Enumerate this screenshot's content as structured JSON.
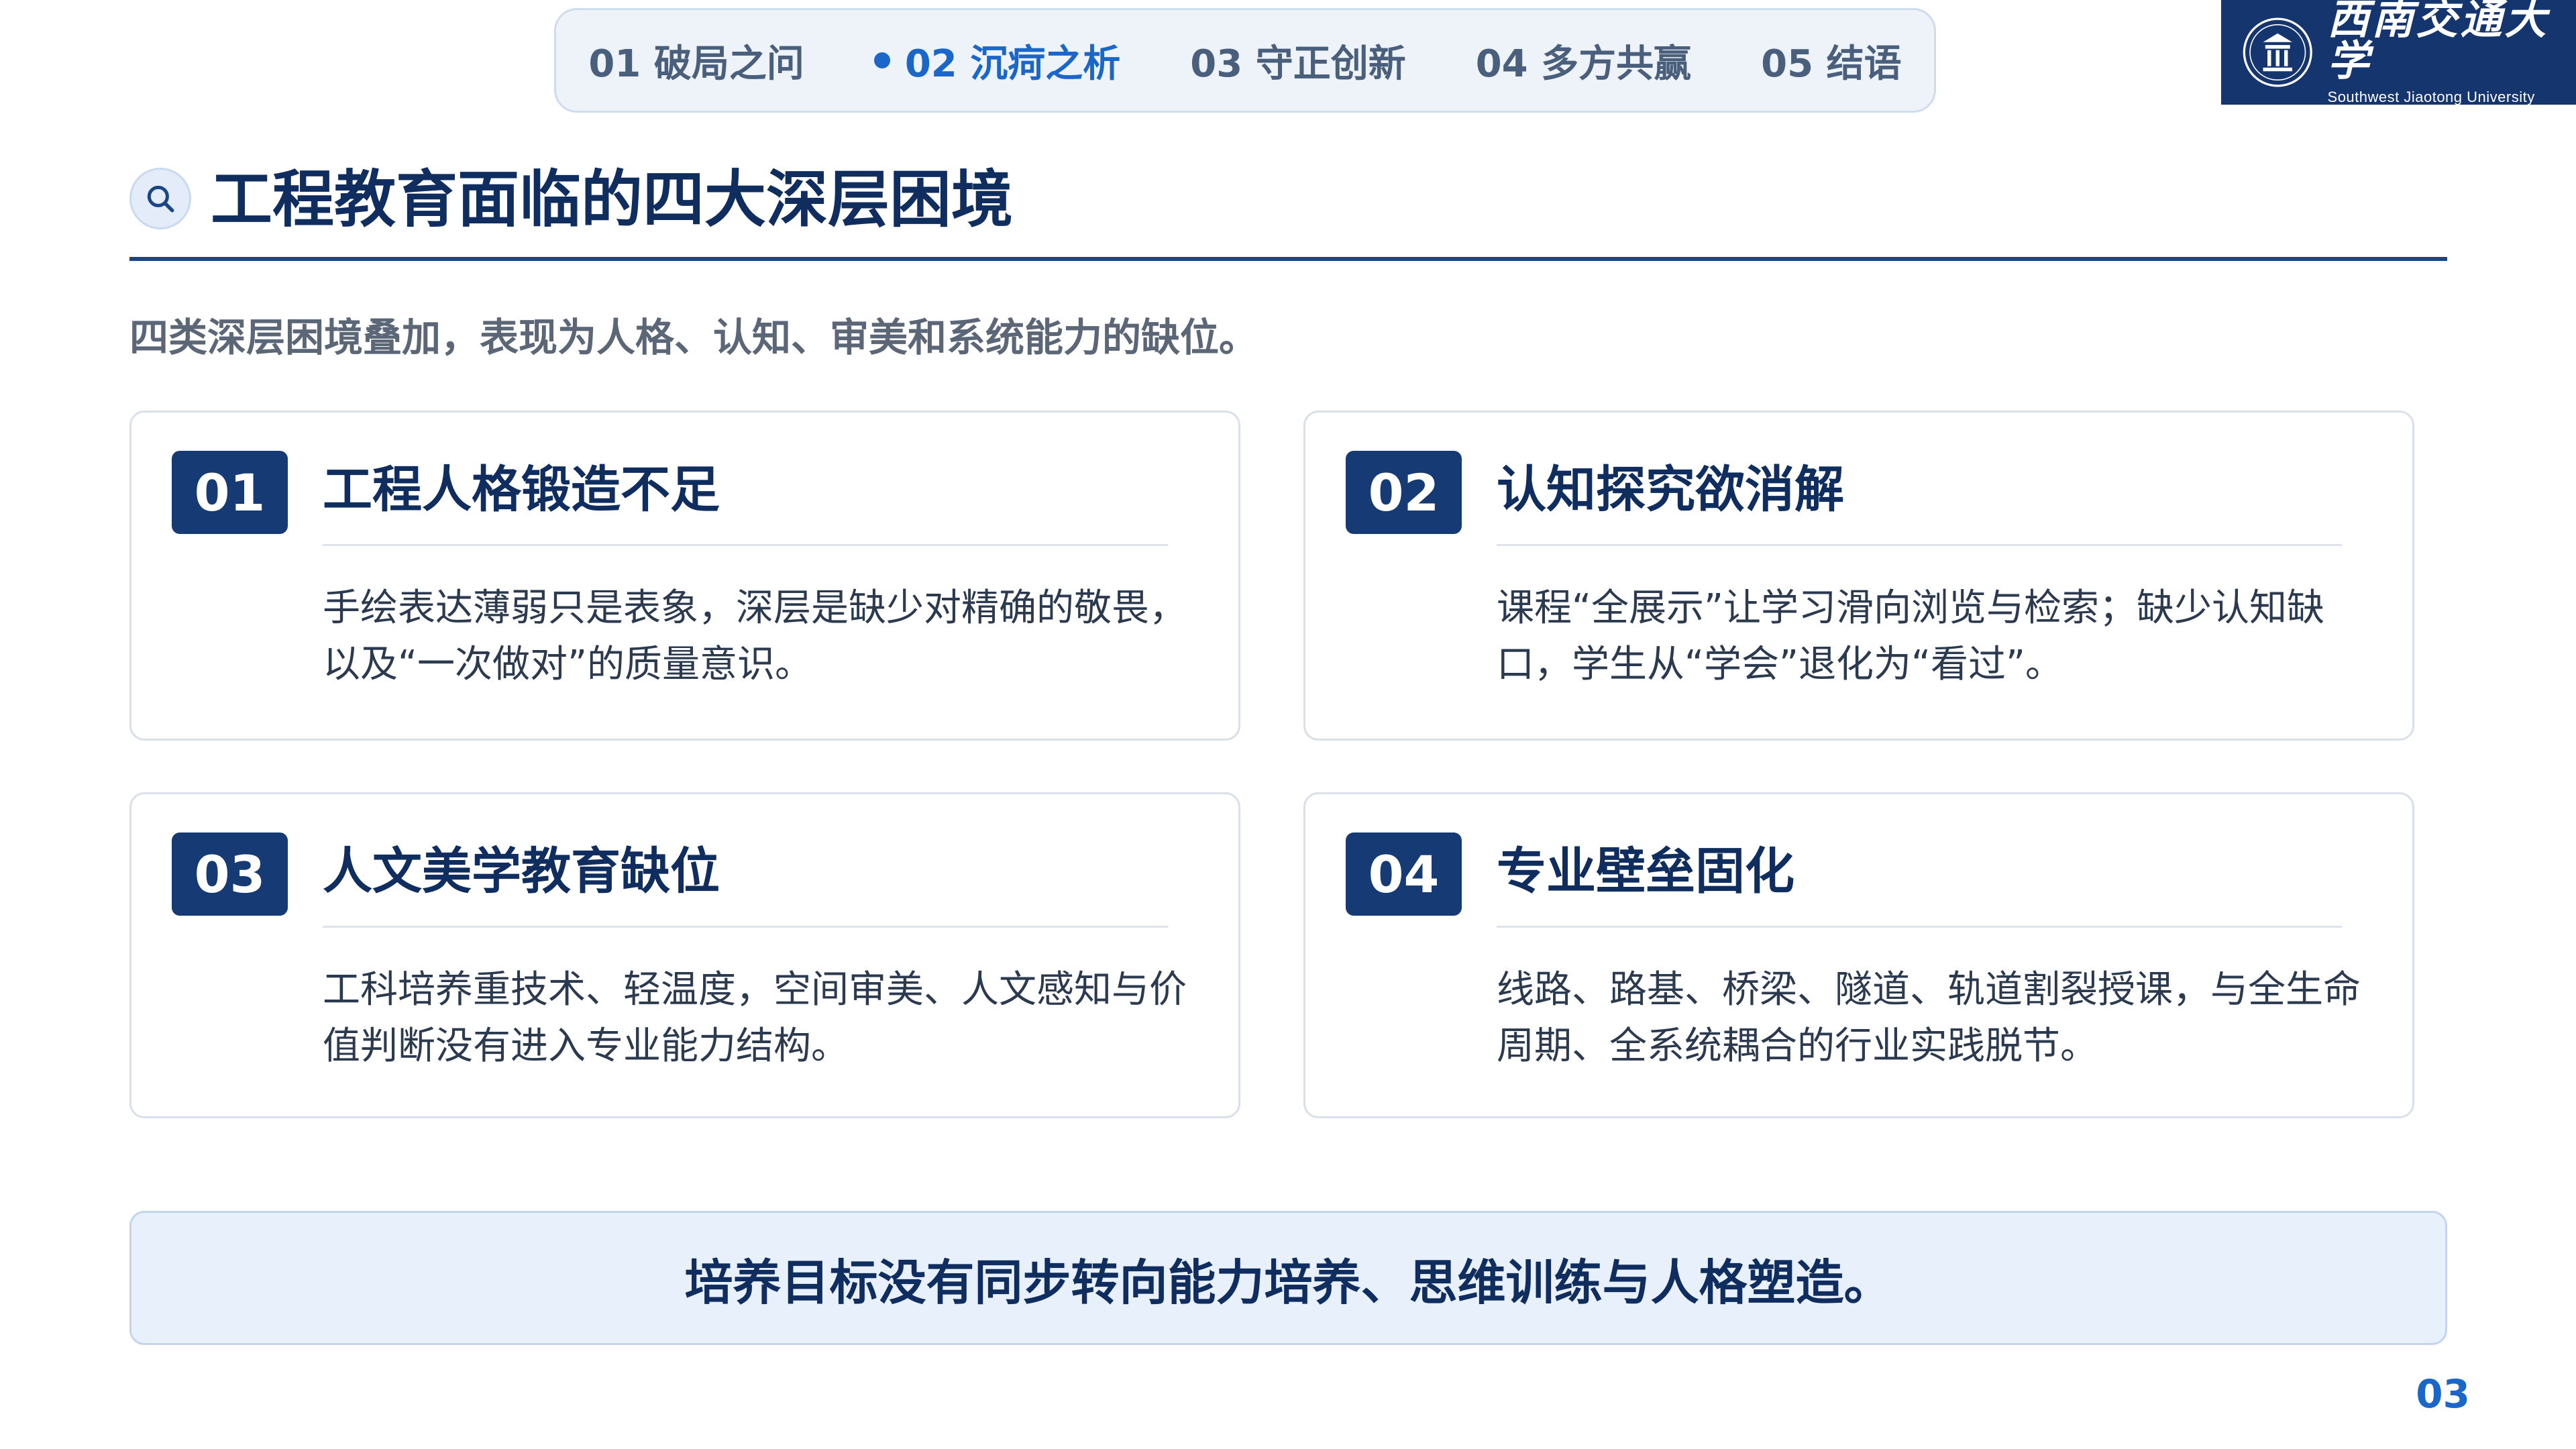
{
  "nav": {
    "items": [
      {
        "label": "01 破局之问",
        "active": false
      },
      {
        "label": "02 沉疴之析",
        "active": true
      },
      {
        "label": "03 守正创新",
        "active": false
      },
      {
        "label": "04 多方共赢",
        "active": false
      },
      {
        "label": "05 结语",
        "active": false
      }
    ]
  },
  "logo": {
    "name_cn": "西南交通大学",
    "name_en": "Southwest Jiaotong University",
    "bg_color": "#15356f"
  },
  "heading": {
    "icon": "search-icon",
    "title": "工程教育面临的四大深层困境",
    "subtitle": "四类深层困境叠加，表现为人格、认知、审美和系统能力的缺位。"
  },
  "cards": [
    {
      "num": "01",
      "title": "工程人格锻造不足",
      "text": "手绘表达薄弱只是表象，深层是缺少对精确的敬畏，以及“一次做对”的质量意识。"
    },
    {
      "num": "02",
      "title": "认知探究欲消解",
      "text": "课程“全展示”让学习滑向浏览与检索；缺少认知缺口，学生从“学会”退化为“看过”。"
    },
    {
      "num": "03",
      "title": "人文美学教育缺位",
      "text": "工科培养重技术、轻温度，空间审美、人文感知与价值判断没有进入专业能力结构。"
    },
    {
      "num": "04",
      "title": "专业壁垒固化",
      "text": "线路、路基、桥梁、隧道、轨道割裂授课，与全生命周期、全系统耦合的行业实践脱节。"
    }
  ],
  "banner": {
    "text": "培养目标没有同步转向能力培养、思维训练与人格塑造。"
  },
  "page_number": "03",
  "colors": {
    "primary": "#163a74",
    "accent": "#1a67c9",
    "banner_bg": "#e8f0fb"
  }
}
